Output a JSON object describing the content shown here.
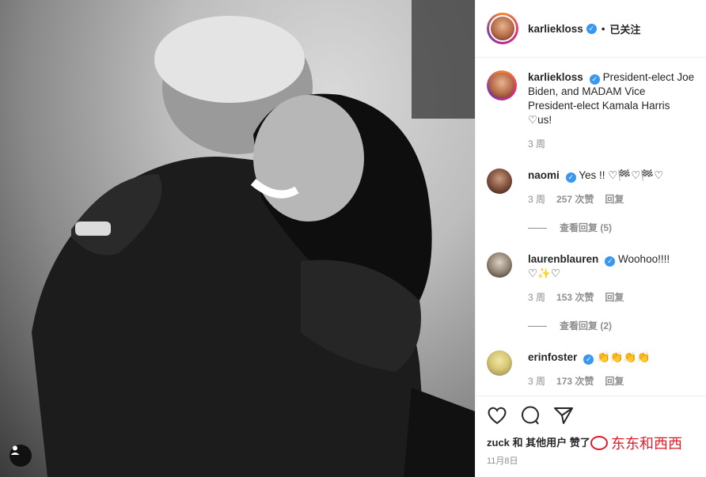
{
  "post": {
    "author": "karliekloss",
    "follow_status": "已关注",
    "caption": "President-elect Joe Biden, and MADAM Vice President-elect Kamala Harris ♡us!",
    "caption_age": "3 周"
  },
  "comments": [
    {
      "username": "naomi",
      "text": "Yes !! ♡🏁♡🏁♡",
      "age": "3 周",
      "likes": "257 次赞",
      "reply_label": "回复",
      "view_replies": "查看回复 (5)"
    },
    {
      "username": "laurenblauren",
      "text": "Woohoo!!!!♡✨♡",
      "age": "3 周",
      "likes": "153 次赞",
      "reply_label": "回复",
      "view_replies": "查看回复 (2)"
    },
    {
      "username": "erinfoster",
      "text": "👏👏👏👏",
      "age": "3 周",
      "likes": "173 次赞",
      "reply_label": "回复"
    }
  ],
  "actions": {
    "liked_by": "zuck 和 其他用户 赞了",
    "date": "11月8日"
  },
  "watermark": "东东和西西",
  "icons": [
    "heart-icon",
    "comment-icon",
    "share-icon",
    "user-tag-icon",
    "verified-icon"
  ]
}
